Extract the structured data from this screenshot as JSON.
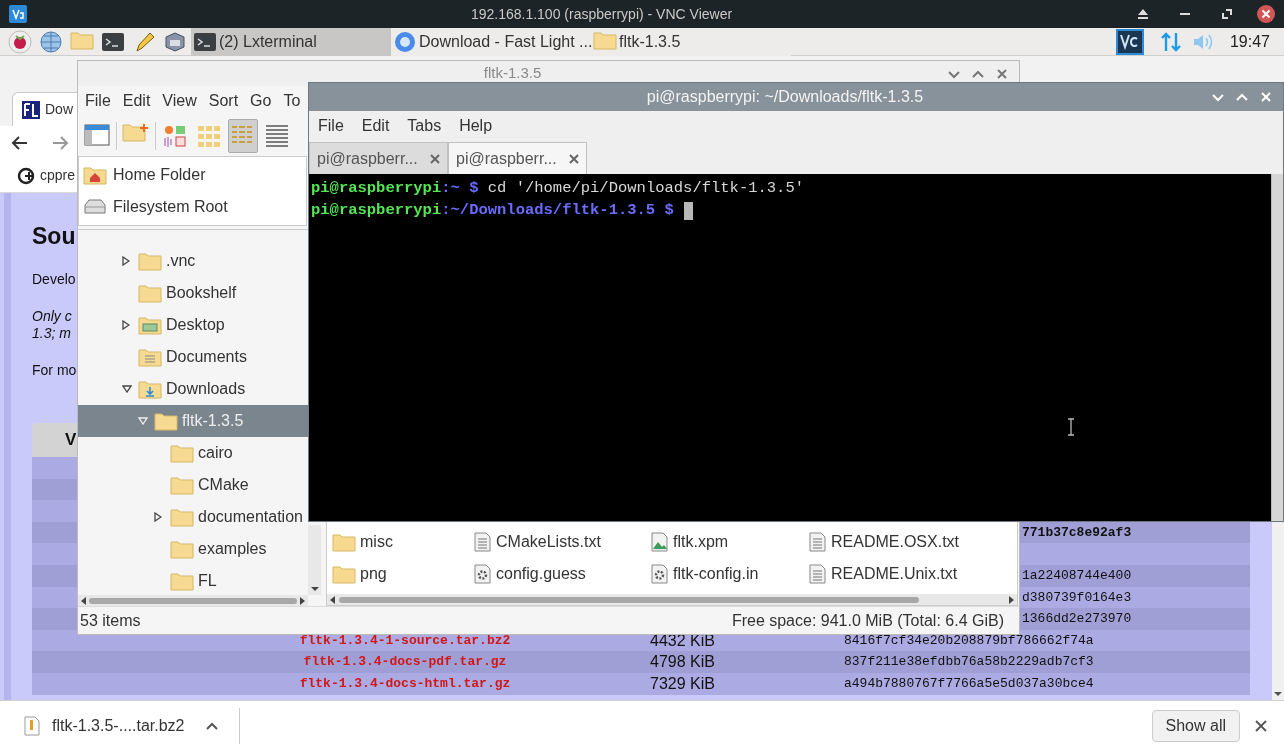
{
  "vnc": {
    "title": "192.168.1.100 (raspberrypi) - VNC Viewer"
  },
  "taskbar": {
    "launchers": [
      {
        "kind": "raspberry"
      },
      {
        "kind": "globe"
      },
      {
        "kind": "folder"
      },
      {
        "kind": "terminal"
      },
      {
        "kind": "pencil"
      },
      {
        "kind": "cube"
      }
    ],
    "tasks": [
      {
        "label": "(2) Lxterminal",
        "kind": "terminal",
        "selected": true
      },
      {
        "label": "Download - Fast Light ...",
        "kind": "browser",
        "selected": false
      },
      {
        "label": "fltk-1.3.5",
        "kind": "folder",
        "selected": false
      }
    ],
    "clock": "19:47"
  },
  "browser": {
    "tab": "Dow",
    "bookmark": "cppre",
    "page": {
      "heading": "Sou",
      "paragraphs": [
        {
          "kind": "plain",
          "lines": [
            "Develo"
          ]
        },
        {
          "kind": "italic",
          "lines": [
            "Only c",
            "1.3; m"
          ]
        },
        {
          "kind": "plain",
          "lines": [
            "For mo"
          ]
        }
      ],
      "table": {
        "header": "V",
        "rows": [
          {},
          {},
          {},
          {
            "kind": "partial",
            "column_3": "771b37c8e92af3",
            "bold": true
          },
          {},
          {
            "kind": "partial",
            "column_3": "1a22408744e400",
            "bold": false
          },
          {
            "kind": "partial",
            "column_3": "d380739f0164e3",
            "bold": false
          },
          {
            "kind": "partial",
            "column_3": "1366dd2e273970",
            "bold": false
          },
          {
            "kind": "full",
            "file": "fltk-1.3.4-1-source.tar.bz2",
            "size": "4432 KiB",
            "hash": "8416f7cf34e20b208879bf786662f74a",
            "bold": false
          },
          {
            "kind": "full",
            "file": "fltk-1.3.4-docs-pdf.tar.gz",
            "size": "4798 KiB",
            "hash": "837f211e38efdbb76a58b2229adb7cf3",
            "bold": false
          },
          {
            "kind": "full",
            "file": "fltk-1.3.4-docs-html.tar.gz",
            "size": "7329 KiB",
            "hash": "a494b7880767f7766a5e5d037a30bce4",
            "bold": false
          }
        ]
      }
    },
    "download": {
      "file": "fltk-1.3.5-....tar.bz2",
      "button": "Show all"
    }
  },
  "file_manager": {
    "title": "fltk-1.3.5",
    "menu": [
      "File",
      "Edit",
      "View",
      "Sort",
      "Go",
      "To"
    ],
    "toolbar": [
      {
        "kind": "new-window",
        "selected": false
      },
      {
        "kind": "new-folder",
        "selected": false
      },
      {
        "kind": "thumbnails",
        "selected": false
      },
      {
        "kind": "icons",
        "selected": false
      },
      {
        "kind": "list",
        "selected": true
      },
      {
        "kind": "compact",
        "selected": false
      }
    ],
    "places": [
      {
        "label": "Home Folder",
        "kind": "home"
      },
      {
        "label": "Filesystem Root",
        "kind": "drive"
      }
    ],
    "tree": [
      {
        "label": ".vnc",
        "kind": "folder",
        "expanded": false,
        "selected": false
      },
      {
        "label": "Bookshelf",
        "kind": "folder",
        "selected": false
      },
      {
        "label": "Desktop",
        "kind": "desktop",
        "expanded": false,
        "selected": false
      },
      {
        "label": "Documents",
        "kind": "documents",
        "selected": false
      },
      {
        "label": "Downloads",
        "kind": "downloads",
        "expanded": true,
        "selected": false,
        "children": [
          {
            "label": "fltk-1.3.5",
            "kind": "folder",
            "expanded": true,
            "selected": true,
            "children": [
              {
                "label": "cairo",
                "kind": "folder",
                "selected": false
              },
              {
                "label": "CMake",
                "kind": "folder",
                "selected": false
              },
              {
                "label": "documentation",
                "kind": "folder",
                "expanded": false,
                "selected": false
              },
              {
                "label": "examples",
                "kind": "folder",
                "selected": false
              },
              {
                "label": "FL",
                "kind": "folder",
                "selected": false
              }
            ]
          }
        ]
      }
    ],
    "files": [
      {
        "label": "misc",
        "kind": "folder"
      },
      {
        "label": "CMakeLists.txt",
        "kind": "text"
      },
      {
        "label": "fltk.xpm",
        "kind": "image"
      },
      {
        "label": "README.OSX.txt",
        "kind": "text"
      },
      {
        "label": "png",
        "kind": "folder"
      },
      {
        "label": "config.guess",
        "kind": "script"
      },
      {
        "label": "fltk-config.in",
        "kind": "script"
      },
      {
        "label": "README.Unix.txt",
        "kind": "text"
      }
    ],
    "status_left": "53 items",
    "status_right": "Free space: 941.0 MiB (Total: 6.4 GiB)"
  },
  "terminal": {
    "title": "pi@raspberrypi: ~/Downloads/fltk-1.3.5",
    "menu": [
      "File",
      "Edit",
      "Tabs",
      "Help"
    ],
    "tabs": [
      {
        "label": "pi@raspberr...",
        "selected": false
      },
      {
        "label": "pi@raspberr...",
        "selected": true
      }
    ],
    "lines": [
      [
        {
          "kind": "user",
          "text": "pi@raspberrypi"
        },
        {
          "kind": "path",
          "text": ":~ $"
        },
        {
          "kind": "command",
          "text": " cd '/home/pi/Downloads/fltk-1.3.5'"
        }
      ],
      [
        {
          "kind": "user",
          "text": "pi@raspberrypi"
        },
        {
          "kind": "path",
          "text": ":~/Downloads/fltk-1.3.5 $"
        }
      ]
    ],
    "cursor": true
  }
}
